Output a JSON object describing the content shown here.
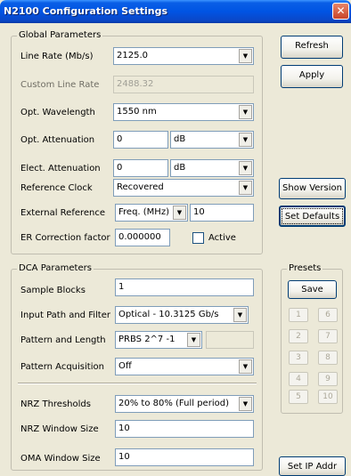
{
  "window": {
    "title": "N2100 Configuration Settings",
    "close_glyph": "✕"
  },
  "global": {
    "legend": "Global Parameters",
    "line_rate": {
      "label": "Line Rate (Mb/s)",
      "value": "2125.0"
    },
    "custom_line_rate": {
      "label": "Custom Line Rate",
      "value": "2488.32"
    },
    "opt_wavelength": {
      "label": "Opt. Wavelength",
      "value": "1550 nm"
    },
    "opt_attenuation": {
      "label": "Opt. Attenuation",
      "value": "0",
      "unit": "dB"
    },
    "elect_attenuation": {
      "label": "Elect. Attenuation",
      "value": "0",
      "unit": "dB"
    },
    "reference_clock": {
      "label": "Reference Clock",
      "value": "Recovered"
    },
    "external_reference": {
      "label": "External Reference",
      "mode": "Freq. (MHz)",
      "value": "10"
    },
    "er_correction": {
      "label": "ER Correction factor",
      "value": "0.000000",
      "active_label": "Active"
    }
  },
  "buttons": {
    "refresh": "Refresh",
    "apply": "Apply",
    "show_version": "Show Version",
    "set_defaults": "Set Defaults",
    "save": "Save",
    "set_ip": "Set IP Addr"
  },
  "dca": {
    "legend": "DCA Parameters",
    "sample_blocks": {
      "label": "Sample Blocks",
      "value": "1"
    },
    "input_path": {
      "label": "Input Path and Filter",
      "value": "Optical - 10.3125 Gb/s"
    },
    "pattern_length": {
      "label": "Pattern and Length",
      "value": "PRBS 2^7 -1",
      "extra": ""
    },
    "pattern_acquisition": {
      "label": "Pattern Acquisition",
      "value": "Off"
    },
    "nrz_thresholds": {
      "label": "NRZ Thresholds",
      "value": "20% to 80%  (Full period)"
    },
    "nrz_window": {
      "label": "NRZ Window Size",
      "value": "10"
    },
    "oma_window": {
      "label": "OMA Window Size",
      "value": "10"
    }
  },
  "presets": {
    "legend": "Presets",
    "left": [
      "1",
      "2",
      "3",
      "4",
      "5"
    ],
    "right": [
      "6",
      "7",
      "8",
      "9",
      "10"
    ]
  }
}
